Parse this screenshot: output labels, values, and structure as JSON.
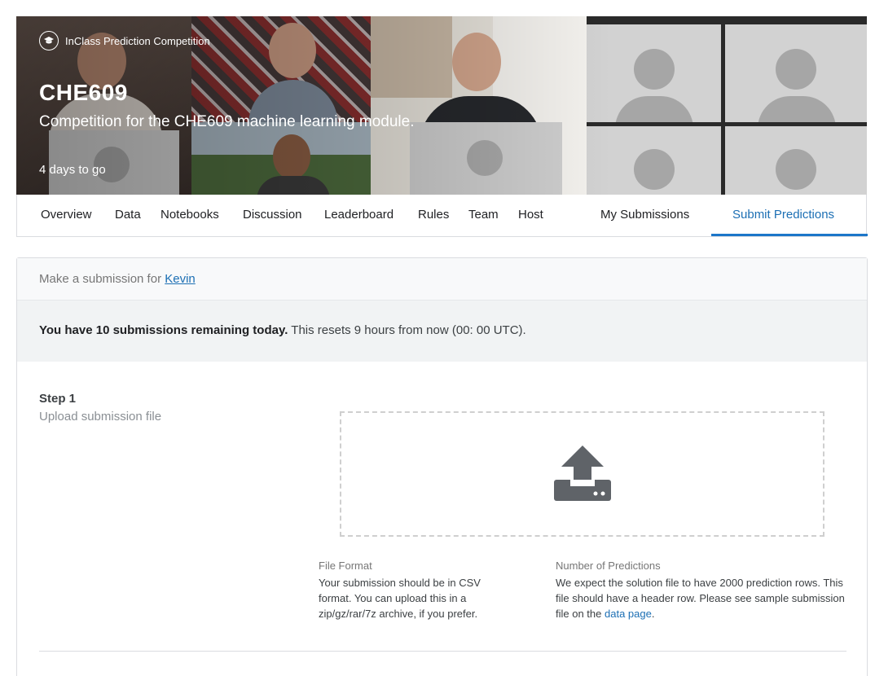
{
  "competition": {
    "type_label": "InClass Prediction Competition",
    "title": "CHE609",
    "subtitle": "Competition for the CHE609 machine learning module.",
    "deadline": "4 days to go"
  },
  "tabs": {
    "overview": "Overview",
    "data": "Data",
    "notebooks": "Notebooks",
    "discussion": "Discussion",
    "leaderboard": "Leaderboard",
    "rules": "Rules",
    "team": "Team",
    "host": "Host",
    "my_submissions": "My Submissions",
    "submit_predictions": "Submit Predictions",
    "active": "submit_predictions"
  },
  "submission": {
    "header_prefix": "Make a submission for",
    "team_name": "Kevin",
    "remaining_bold": "You have 10 submissions remaining today.",
    "remaining_rest": "This resets 9 hours from now (00: 00 UTC).",
    "step_label": "Step 1",
    "step_desc": "Upload submission file",
    "file_format_title": "File Format",
    "file_format_text": "Your submission should be in CSV format. You can upload this in a zip/gz/rar/7z archive, if you prefer.",
    "predictions_title": "Number of Predictions",
    "predictions_text": "We expect the solution file to have 2000 prediction rows. This file should have a header row. Please see sample submission file on the",
    "predictions_link": "data page",
    "predictions_end": "."
  },
  "icons": {
    "competition_type": "graduation-cap-icon",
    "upload": "upload-icon"
  },
  "colors": {
    "accent": "#1c6fb4",
    "tab_underline": "#1c76c9",
    "upload_icon": "#5f6368"
  }
}
